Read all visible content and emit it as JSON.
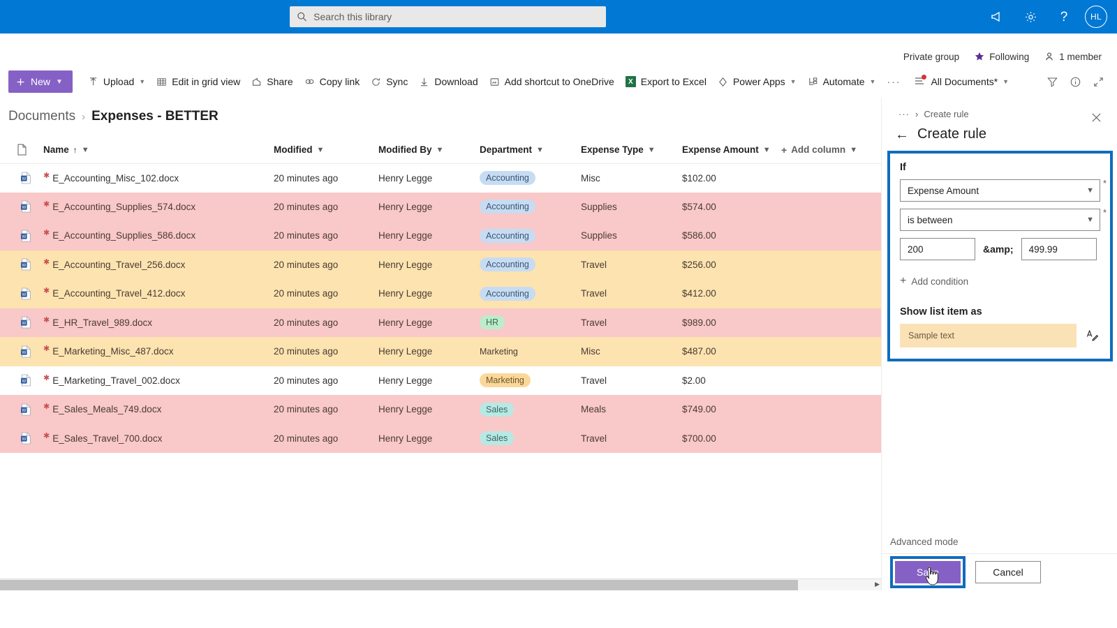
{
  "suite": {
    "search_placeholder": "Search this library",
    "search_value": "",
    "icons": {
      "megaphone": "megaphone-icon",
      "settings": "gear-icon",
      "help": "help-icon"
    },
    "avatar_initials": "HL",
    "bar_color": "#0078d4"
  },
  "site_meta": {
    "privacy": "Private group",
    "follow": "Following",
    "members": "1 member"
  },
  "commandbar": {
    "new_label": "New",
    "items": [
      {
        "label": "Upload",
        "icon": "upload-icon",
        "has_chevron": true
      },
      {
        "label": "Edit in grid view",
        "icon": "grid-icon",
        "has_chevron": false
      },
      {
        "label": "Share",
        "icon": "share-icon",
        "has_chevron": false
      },
      {
        "label": "Copy link",
        "icon": "link-icon",
        "has_chevron": false
      },
      {
        "label": "Sync",
        "icon": "sync-icon",
        "has_chevron": false
      },
      {
        "label": "Download",
        "icon": "download-icon",
        "has_chevron": false
      },
      {
        "label": "Add shortcut to OneDrive",
        "icon": "onedrive-shortcut-icon",
        "has_chevron": false
      },
      {
        "label": "Export to Excel",
        "icon": "excel-icon",
        "has_chevron": false
      },
      {
        "label": "Power Apps",
        "icon": "powerapps-icon",
        "has_chevron": true
      },
      {
        "label": "Automate",
        "icon": "automate-icon",
        "has_chevron": true
      }
    ],
    "overflow_label": "···",
    "view_label": "All Documents*",
    "right_icons": [
      "filter-icon",
      "info-icon",
      "expand-icon"
    ]
  },
  "breadcrumb": {
    "root": "Documents",
    "separator": "›",
    "current": "Expenses - BETTER"
  },
  "table": {
    "columns": [
      {
        "label": "Name",
        "sorted": true,
        "sort_arrow": "↑"
      },
      {
        "label": "Modified"
      },
      {
        "label": "Modified By"
      },
      {
        "label": "Department"
      },
      {
        "label": "Expense Type"
      },
      {
        "label": "Expense Amount"
      },
      {
        "label": "Add column"
      }
    ],
    "rows": [
      {
        "name": "E_Accounting_Misc_102.docx",
        "modified": "20 minutes ago",
        "modified_by": "Henry Legge",
        "department": "Accounting",
        "dept_style": "accounting",
        "expense_type": "Misc",
        "amount": "$102.00",
        "row_color": "white"
      },
      {
        "name": "E_Accounting_Supplies_574.docx",
        "modified": "20 minutes ago",
        "modified_by": "Henry Legge",
        "department": "Accounting",
        "dept_style": "accounting",
        "expense_type": "Supplies",
        "amount": "$574.00",
        "row_color": "pink"
      },
      {
        "name": "E_Accounting_Supplies_586.docx",
        "modified": "20 minutes ago",
        "modified_by": "Henry Legge",
        "department": "Accounting",
        "dept_style": "accounting",
        "expense_type": "Supplies",
        "amount": "$586.00",
        "row_color": "pink"
      },
      {
        "name": "E_Accounting_Travel_256.docx",
        "modified": "20 minutes ago",
        "modified_by": "Henry Legge",
        "department": "Accounting",
        "dept_style": "accounting",
        "expense_type": "Travel",
        "amount": "$256.00",
        "row_color": "yellow"
      },
      {
        "name": "E_Accounting_Travel_412.docx",
        "modified": "20 minutes ago",
        "modified_by": "Henry Legge",
        "department": "Accounting",
        "dept_style": "accounting",
        "expense_type": "Travel",
        "amount": "$412.00",
        "row_color": "yellow"
      },
      {
        "name": "E_HR_Travel_989.docx",
        "modified": "20 minutes ago",
        "modified_by": "Henry Legge",
        "department": "HR",
        "dept_style": "hr",
        "expense_type": "Travel",
        "amount": "$989.00",
        "row_color": "pink"
      },
      {
        "name": "E_Marketing_Misc_487.docx",
        "modified": "20 minutes ago",
        "modified_by": "Henry Legge",
        "department": "Marketing",
        "dept_style": "none",
        "expense_type": "Misc",
        "amount": "$487.00",
        "row_color": "yellow"
      },
      {
        "name": "E_Marketing_Travel_002.docx",
        "modified": "20 minutes ago",
        "modified_by": "Henry Legge",
        "department": "Marketing",
        "dept_style": "marketing",
        "expense_type": "Travel",
        "amount": "$2.00",
        "row_color": "white"
      },
      {
        "name": "E_Sales_Meals_749.docx",
        "modified": "20 minutes ago",
        "modified_by": "Henry Legge",
        "department": "Sales",
        "dept_style": "sales",
        "expense_type": "Meals",
        "amount": "$749.00",
        "row_color": "pink"
      },
      {
        "name": "E_Sales_Travel_700.docx",
        "modified": "20 minutes ago",
        "modified_by": "Henry Legge",
        "department": "Sales",
        "dept_style": "sales",
        "expense_type": "Travel",
        "amount": "$700.00",
        "row_color": "pink"
      }
    ]
  },
  "panel": {
    "crumb_dots": "···",
    "crumb_sep": "›",
    "crumb_current": "Create rule",
    "title": "Create rule",
    "if_label": "If",
    "column_select": "Expense Amount",
    "operator_select": "is between",
    "range_from": "200",
    "range_joiner": "&amp;",
    "range_to": "499.99",
    "add_condition": "Add condition",
    "show_label": "Show list item as",
    "sample_text": "Sample text",
    "sample_fill": "#fbe2b6",
    "advanced_mode": "Advanced mode",
    "save_label": "Save",
    "cancel_label": "Cancel",
    "highlight_color": "#0f6cbd",
    "accent_color": "#8661c5"
  }
}
